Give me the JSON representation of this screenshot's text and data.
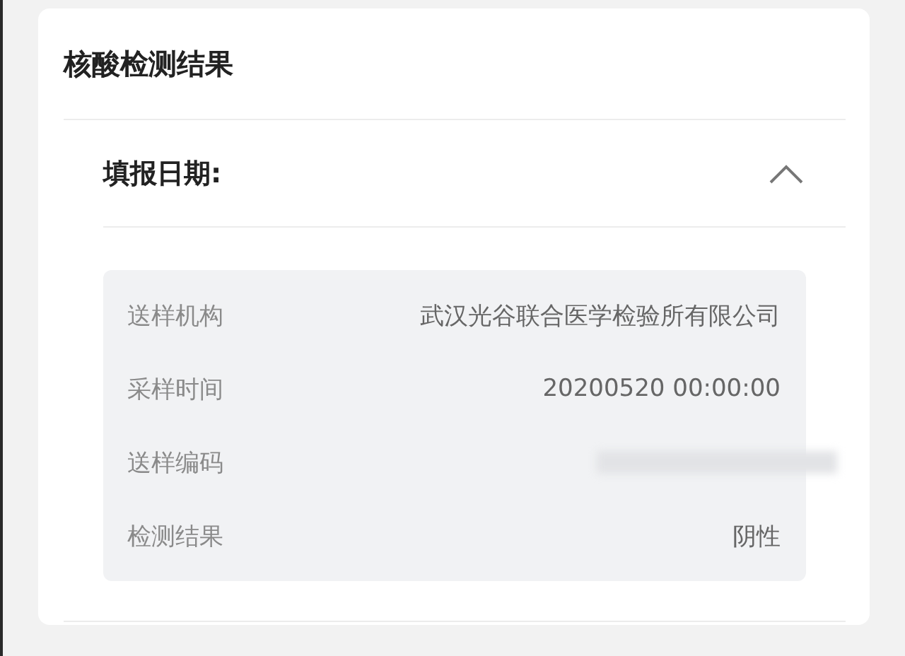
{
  "card": {
    "title": "核酸检测结果",
    "section": {
      "title": "填报日期:",
      "expanded": true,
      "rows": [
        {
          "kind": "text",
          "label": "送样机构",
          "value": "武汉光谷联合医学检验所有限公司"
        },
        {
          "kind": "text",
          "label": "采样时间",
          "value": "20200520 00:00:00"
        },
        {
          "kind": "redacted",
          "label": "送样编码"
        },
        {
          "kind": "text",
          "label": "检测结果",
          "value": "阴性"
        }
      ]
    }
  }
}
